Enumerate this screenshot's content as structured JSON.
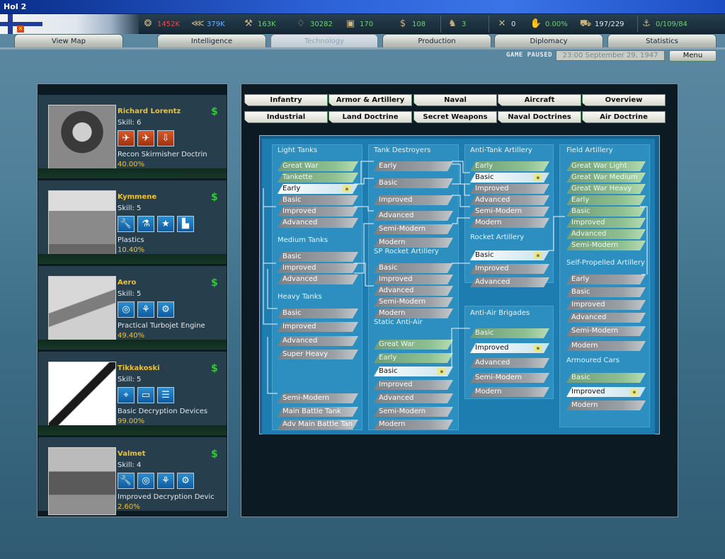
{
  "window": {
    "title": "HoI 2"
  },
  "resources": [
    {
      "icon": "gear-icon",
      "value": "1452K",
      "color": "#e05050"
    },
    {
      "icon": "metal-icon",
      "value": "379K",
      "color": "#6fb0ff"
    },
    {
      "icon": "crane-icon",
      "value": "163K",
      "color": "#6fd06f"
    },
    {
      "icon": "oil-icon",
      "value": "30282",
      "color": "#6fd06f"
    },
    {
      "icon": "supplies-icon",
      "value": "170",
      "color": "#6fd06f"
    },
    {
      "icon": "money-icon",
      "value": "108",
      "color": "#6fd06f"
    },
    {
      "icon": "manpower-icon",
      "value": "3",
      "color": "#6fd06f"
    },
    {
      "icon": "transport-icon",
      "value": "0",
      "color": "#e3e8ec"
    },
    {
      "icon": "dissent-icon",
      "value": "0.00%",
      "color": "#6fd06f"
    },
    {
      "icon": "convoy-icon",
      "value": "197/229",
      "color": "#e3e8ec"
    },
    {
      "icon": "escort-icon",
      "value": "0/109/84",
      "color": "#6fd06f"
    }
  ],
  "tabs": [
    "View Map",
    "Intelligence",
    "Technology",
    "Production",
    "Diplomacy",
    "Statistics"
  ],
  "status": {
    "paused": "GAME PAUSED",
    "date": "23:00 September 29, 1947",
    "menu": "Menu"
  },
  "teams": [
    {
      "name": "Richard Lorentz",
      "skill": "Skill: 6",
      "project": "Recon Skirmisher Doctrin",
      "progress": "40.00%",
      "icons": [
        "bomber-icon",
        "fighter-icon",
        "rocket-icon"
      ],
      "icon_color": "red",
      "glyphs": [
        "✈",
        "✈",
        "⇩"
      ]
    },
    {
      "name": "Kymmene",
      "skill": "Skill: 5",
      "project": "Plastics",
      "progress": "10.40%",
      "icons": [
        "wrench-icon",
        "flask-icon",
        "star-icon",
        "factory-icon"
      ],
      "icon_color": "blue",
      "glyphs": [
        "🔧",
        "⚗",
        "★",
        "▙"
      ]
    },
    {
      "name": "Aero",
      "skill": "Skill: 5",
      "project": "Practical Turbojet Engine",
      "progress": "49.40%",
      "icons": [
        "bulb-icon",
        "propeller-icon",
        "gears-icon"
      ],
      "icon_color": "blue",
      "glyphs": [
        "◎",
        "⚘",
        "⚙"
      ]
    },
    {
      "name": "Tikkakoski",
      "skill": "Skill: 5",
      "project": "Basic Decryption Devices",
      "progress": "99.00%",
      "icons": [
        "satellite-icon",
        "book-icon",
        "document-icon"
      ],
      "icon_color": "blue",
      "glyphs": [
        "⌖",
        "▭",
        "☰"
      ]
    },
    {
      "name": "Valmet",
      "skill": "Skill: 4",
      "project": "Improved Decryption Devic",
      "progress": "2.60%",
      "icons": [
        "wrench-icon",
        "bulb-icon",
        "propeller-icon",
        "gears-icon"
      ],
      "icon_color": "blue",
      "glyphs": [
        "🔧",
        "◎",
        "⚘",
        "⚙"
      ]
    }
  ],
  "categories_row1": [
    "Infantry",
    "Armor & Artillery",
    "Naval",
    "Aircraft",
    "Overview"
  ],
  "categories_row2": [
    "Industrial",
    "Land Doctrine",
    "Secret Weapons",
    "Naval Doctrines",
    "Air Doctrine"
  ],
  "groups": [
    {
      "name": "Light Tanks",
      "items": [
        {
          "label": "Great War",
          "state": "done"
        },
        {
          "label": "Tankette",
          "state": "done"
        },
        {
          "label": "Early",
          "state": "sel"
        },
        {
          "label": "Basic",
          "state": "todo"
        },
        {
          "label": "Improved",
          "state": "todo"
        },
        {
          "label": "Advanced",
          "state": "todo"
        }
      ]
    },
    {
      "name": "Medium Tanks",
      "items": [
        {
          "label": "Basic",
          "state": "todo"
        },
        {
          "label": "Improved",
          "state": "todo"
        },
        {
          "label": "Advanced",
          "state": "todo"
        }
      ]
    },
    {
      "name": "Heavy Tanks",
      "items": [
        {
          "label": "Basic",
          "state": "todo"
        },
        {
          "label": "Improved",
          "state": "todo"
        },
        {
          "label": "Advanced",
          "state": "todo"
        },
        {
          "label": "Super Heavy",
          "state": "todo"
        },
        {
          "label": "Semi-Modern",
          "state": "todo"
        },
        {
          "label": "Main Battle Tank",
          "state": "todo"
        },
        {
          "label": "Adv Main Battle Tan",
          "state": "todo"
        }
      ]
    },
    {
      "name": "Tank Destroyers",
      "items": [
        {
          "label": "Early",
          "state": "todo"
        },
        {
          "label": "Basic",
          "state": "todo"
        },
        {
          "label": "Improved",
          "state": "todo"
        },
        {
          "label": "Advanced",
          "state": "todo"
        },
        {
          "label": "Semi-Modern",
          "state": "todo"
        },
        {
          "label": "Modern",
          "state": "todo"
        }
      ]
    },
    {
      "name": "SP Rocket Artillery",
      "items": [
        {
          "label": "Basic",
          "state": "todo"
        },
        {
          "label": "Improved",
          "state": "todo"
        },
        {
          "label": "Advanced",
          "state": "todo"
        },
        {
          "label": "Semi-Modern",
          "state": "todo"
        },
        {
          "label": "Modern",
          "state": "todo"
        }
      ]
    },
    {
      "name": "Static Anti-Air",
      "items": [
        {
          "label": "Great War",
          "state": "done"
        },
        {
          "label": "Early",
          "state": "done"
        },
        {
          "label": "Basic",
          "state": "sel"
        },
        {
          "label": "Improved",
          "state": "todo"
        },
        {
          "label": "Advanced",
          "state": "todo"
        },
        {
          "label": "Semi-Modern",
          "state": "todo"
        },
        {
          "label": "Modern",
          "state": "todo"
        }
      ]
    },
    {
      "name": "Anti-Tank Artillery",
      "items": [
        {
          "label": "Early",
          "state": "done"
        },
        {
          "label": "Basic",
          "state": "sel"
        },
        {
          "label": "Improved",
          "state": "todo"
        },
        {
          "label": "Advanced",
          "state": "todo"
        },
        {
          "label": "Semi-Modern",
          "state": "todo"
        },
        {
          "label": "Modern",
          "state": "todo"
        }
      ]
    },
    {
      "name": "Rocket Artillery",
      "items": [
        {
          "label": "Basic",
          "state": "sel"
        },
        {
          "label": "Improved",
          "state": "todo"
        },
        {
          "label": "Advanced",
          "state": "todo"
        }
      ]
    },
    {
      "name": "Anti-Air Brigades",
      "items": [
        {
          "label": "Basic",
          "state": "done"
        },
        {
          "label": "Improved",
          "state": "sel"
        },
        {
          "label": "Advanced",
          "state": "todo"
        },
        {
          "label": "Semi-Modern",
          "state": "todo"
        },
        {
          "label": "Modern",
          "state": "todo"
        }
      ]
    },
    {
      "name": "Field Artillery",
      "items": [
        {
          "label": "Great War Light",
          "state": "done"
        },
        {
          "label": "Great War Medium",
          "state": "done"
        },
        {
          "label": "Great War Heavy",
          "state": "done"
        },
        {
          "label": "Early",
          "state": "done"
        },
        {
          "label": "Basic",
          "state": "done"
        },
        {
          "label": "Improved",
          "state": "done"
        },
        {
          "label": "Advanced",
          "state": "done"
        },
        {
          "label": "Semi-Modern",
          "state": "done"
        }
      ]
    },
    {
      "name": "Self-Propelled Artillery",
      "items": [
        {
          "label": "Early",
          "state": "todo"
        },
        {
          "label": "Basic",
          "state": "todo"
        },
        {
          "label": "Improved",
          "state": "todo"
        },
        {
          "label": "Advanced",
          "state": "todo"
        },
        {
          "label": "Semi-Modern",
          "state": "todo"
        },
        {
          "label": "Modern",
          "state": "todo"
        }
      ]
    },
    {
      "name": "Armoured Cars",
      "items": [
        {
          "label": "Basic",
          "state": "done"
        },
        {
          "label": "Improved",
          "state": "sel"
        },
        {
          "label": "Modern",
          "state": "todo"
        }
      ]
    }
  ]
}
